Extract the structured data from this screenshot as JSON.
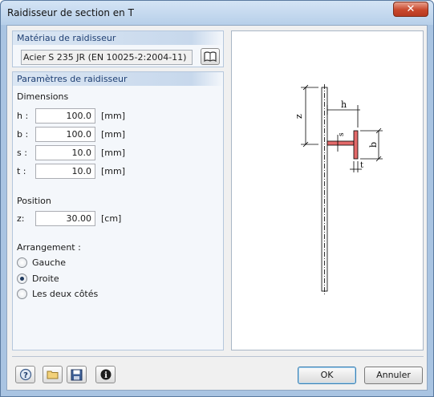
{
  "window": {
    "title": "Raidisseur de section en T",
    "close_label": "✕"
  },
  "material": {
    "header": "Matériau de raidisseur",
    "value": "Acier S 235 JR (EN 10025-2:2004-11)",
    "library_icon": "book-icon"
  },
  "params": {
    "header": "Paramètres de raidisseur",
    "dimensions_label": "Dimensions",
    "fields": [
      {
        "label": "h :",
        "value": "100.0",
        "unit": "[mm]"
      },
      {
        "label": "b :",
        "value": "100.0",
        "unit": "[mm]"
      },
      {
        "label": "s :",
        "value": "10.0",
        "unit": "[mm]"
      },
      {
        "label": "t :",
        "value": "10.0",
        "unit": "[mm]"
      }
    ],
    "position_label": "Position",
    "z": {
      "label": "z:",
      "value": "30.00",
      "unit": "[cm]"
    },
    "arrangement_label": "Arrangement :",
    "options": [
      {
        "label": "Gauche",
        "checked": false
      },
      {
        "label": "Droite",
        "checked": true
      },
      {
        "label": "Les deux côtés",
        "checked": false
      }
    ]
  },
  "diagram": {
    "labels": {
      "z": "z",
      "h": "h",
      "s": "s",
      "b": "b",
      "t": "t"
    },
    "stiffener_color": "#e36a6a"
  },
  "footer": {
    "tools": [
      "help-icon",
      "open-folder-icon",
      "save-icon",
      "info-icon"
    ],
    "ok_label": "OK",
    "cancel_label": "Annuler"
  }
}
